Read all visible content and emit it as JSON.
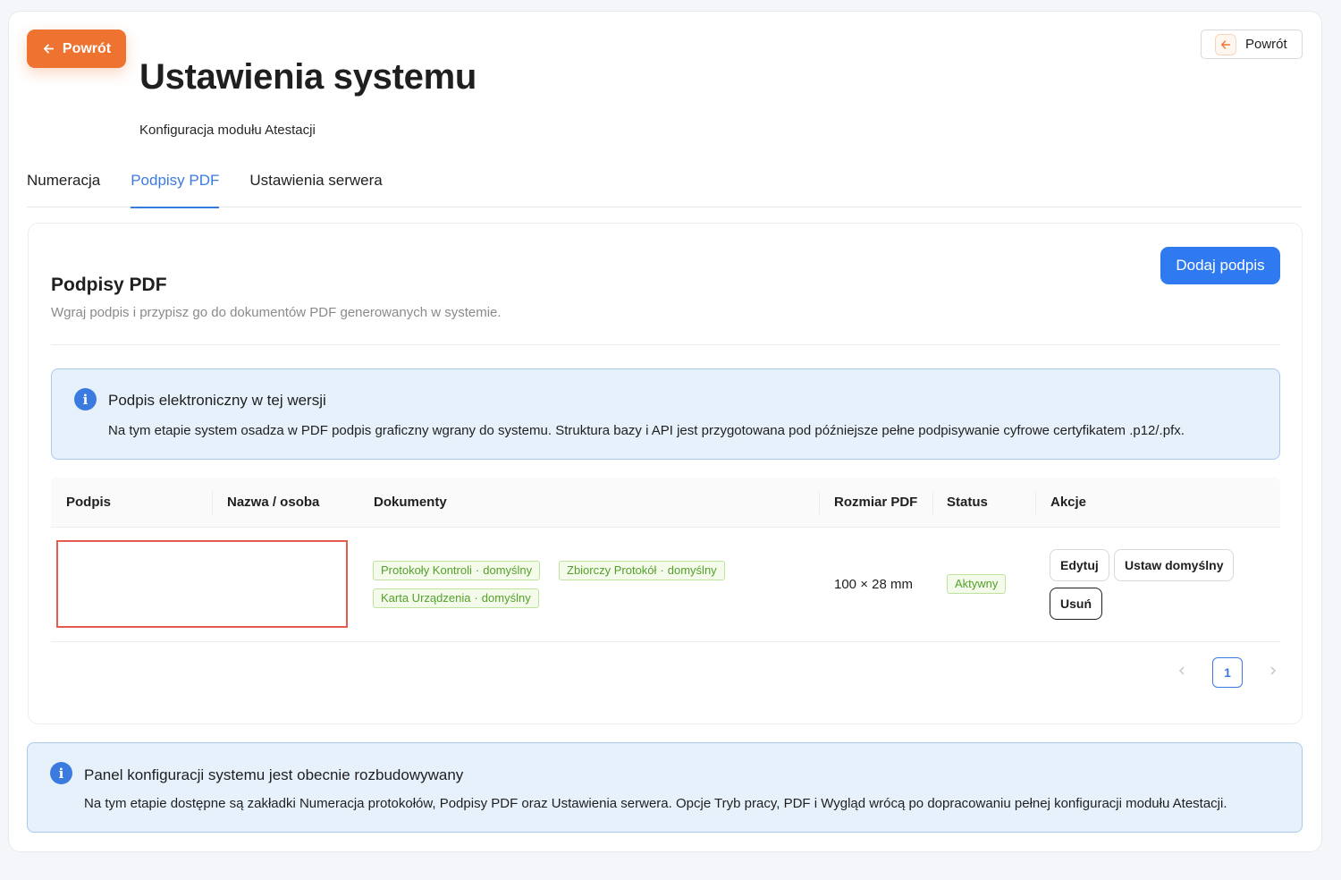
{
  "header": {
    "back_primary_label": "Powrót",
    "back_secondary_label": "Powrót",
    "title": "Ustawienia systemu",
    "subtitle": "Konfiguracja modułu Atestacji"
  },
  "tabs": [
    {
      "label": "Numeracja",
      "active": false
    },
    {
      "label": "Podpisy PDF",
      "active": true
    },
    {
      "label": "Ustawienia serwera",
      "active": false
    }
  ],
  "panel": {
    "title": "Podpisy PDF",
    "description": "Wgraj podpis i przypisz go do dokumentów PDF generowanych w systemie.",
    "add_button": "Dodaj podpis",
    "info": {
      "title": "Podpis elektroniczny w tej wersji",
      "text": "Na tym etapie system osadza w PDF podpis graficzny wgrany do systemu. Struktura bazy i API jest przygotowana pod późniejsze pełne podpisywanie cyfrowe certyfikatem .p12/.pfx."
    },
    "table": {
      "columns": [
        "Podpis",
        "Nazwa / osoba",
        "Dokumenty",
        "Rozmiar PDF",
        "Status",
        "Akcje"
      ],
      "rows": [
        {
          "name": "",
          "documents": [
            {
              "doc": "Protokoły Kontroli",
              "flag": "domyślny"
            },
            {
              "doc": "Zbiorczy Protokół",
              "flag": "domyślny"
            },
            {
              "doc": "Karta Urządzenia",
              "flag": "domyślny"
            }
          ],
          "size": "100 × 28 mm",
          "status": "Aktywny",
          "actions": {
            "edit": "Edytuj",
            "set_default": "Ustaw domyślny",
            "delete": "Usuń"
          }
        }
      ]
    },
    "pagination": {
      "current": "1"
    }
  },
  "bottom_info": {
    "title": "Panel konfiguracji systemu jest obecnie rozbudowywany",
    "text": "Na tym etapie dostępne są zakładki Numeracja protokołów, Podpisy PDF oraz Ustawienia serwera. Opcje Tryb pracy, PDF i Wygląd wrócą po dopracowaniu pełnej konfiguracji modułu Atestacji."
  },
  "colors": {
    "accent_orange": "#ee7330",
    "primary_blue": "#2f7af0",
    "tab_active": "#3b7be0",
    "tag_green": "#54a02c",
    "info_bg": "#e7f1fc",
    "signature_frame": "#e45a4c"
  },
  "icons": {
    "back": "arrow-left-icon",
    "info": "info-circle-icon",
    "pager_prev": "chevron-left-icon",
    "pager_next": "chevron-right-icon"
  }
}
